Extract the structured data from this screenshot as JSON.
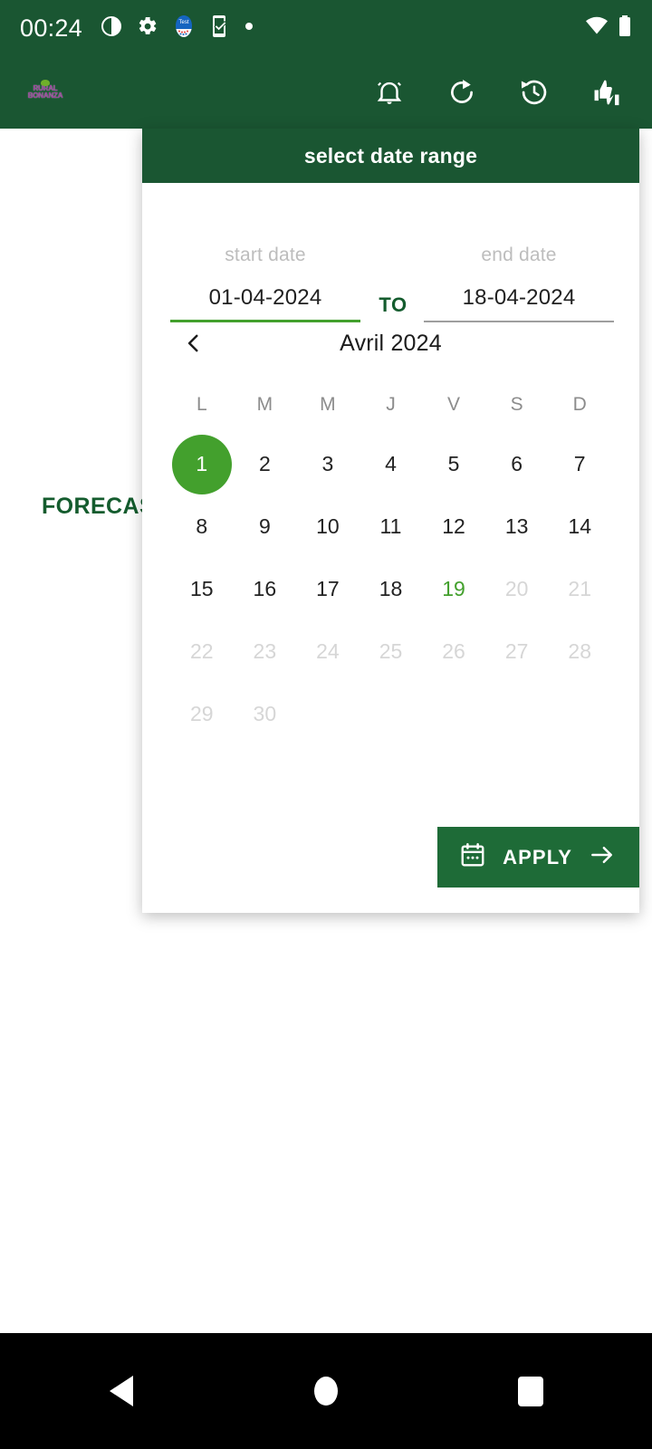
{
  "status_bar": {
    "clock": "00:24",
    "left_icons": [
      "contrast-circle-icon",
      "gear-icon",
      "test-app-icon",
      "phone-check-icon",
      "dot-icon"
    ],
    "right_icons": [
      "wifi-icon",
      "battery-icon"
    ],
    "background": "#1a5632"
  },
  "app_bar": {
    "logo_text": "RURAL BONANZA",
    "background": "#1a5632",
    "actions": [
      {
        "name": "notifications-icon",
        "label": "notifications"
      },
      {
        "name": "refresh-icon",
        "label": "refresh"
      },
      {
        "name": "history-icon",
        "label": "history"
      },
      {
        "name": "feedback-icon",
        "label": "feedback"
      }
    ]
  },
  "page": {
    "forecast_label": "FORECAS"
  },
  "dialog": {
    "title": "select date range",
    "header_background": "#1a5632",
    "start_field": {
      "label": "start date",
      "value": "01-04-2024",
      "underline_color": "#43a02d",
      "active": true
    },
    "separator": "TO",
    "end_field": {
      "label": "end date",
      "value": "18-04-2024",
      "underline_color": "#9e9e9e",
      "active": false
    },
    "calendar": {
      "prev_icon": "chevron-left-icon",
      "month_label": "Avril 2024",
      "weekdays": [
        "L",
        "M",
        "M",
        "J",
        "V",
        "S",
        "D"
      ],
      "leading_blanks": 0,
      "days": [
        {
          "n": "1",
          "state": "selected"
        },
        {
          "n": "2",
          "state": "normal"
        },
        {
          "n": "3",
          "state": "normal"
        },
        {
          "n": "4",
          "state": "normal"
        },
        {
          "n": "5",
          "state": "normal"
        },
        {
          "n": "6",
          "state": "normal"
        },
        {
          "n": "7",
          "state": "normal"
        },
        {
          "n": "8",
          "state": "normal"
        },
        {
          "n": "9",
          "state": "normal"
        },
        {
          "n": "10",
          "state": "normal"
        },
        {
          "n": "11",
          "state": "normal"
        },
        {
          "n": "12",
          "state": "normal"
        },
        {
          "n": "13",
          "state": "normal"
        },
        {
          "n": "14",
          "state": "normal"
        },
        {
          "n": "15",
          "state": "normal"
        },
        {
          "n": "16",
          "state": "normal"
        },
        {
          "n": "17",
          "state": "normal"
        },
        {
          "n": "18",
          "state": "normal"
        },
        {
          "n": "19",
          "state": "today"
        },
        {
          "n": "20",
          "state": "muted"
        },
        {
          "n": "21",
          "state": "muted"
        },
        {
          "n": "22",
          "state": "muted"
        },
        {
          "n": "23",
          "state": "muted"
        },
        {
          "n": "24",
          "state": "muted"
        },
        {
          "n": "25",
          "state": "muted"
        },
        {
          "n": "26",
          "state": "muted"
        },
        {
          "n": "27",
          "state": "muted"
        },
        {
          "n": "28",
          "state": "muted"
        },
        {
          "n": "29",
          "state": "muted"
        },
        {
          "n": "30",
          "state": "muted"
        }
      ],
      "selected_color": "#43a02d",
      "today_color": "#43a02d",
      "disabled_color": "#d6d6d6"
    },
    "apply_button": {
      "label": "APPLY",
      "leading_icon": "calendar-icon",
      "trailing_icon": "arrow-right-icon",
      "background": "#1e6b37"
    }
  },
  "nav_bar": {
    "background": "#000000",
    "buttons": [
      {
        "name": "nav-back-button",
        "icon": "triangle-left-icon"
      },
      {
        "name": "nav-home-button",
        "icon": "circle-icon"
      },
      {
        "name": "nav-recents-button",
        "icon": "square-icon"
      }
    ]
  }
}
